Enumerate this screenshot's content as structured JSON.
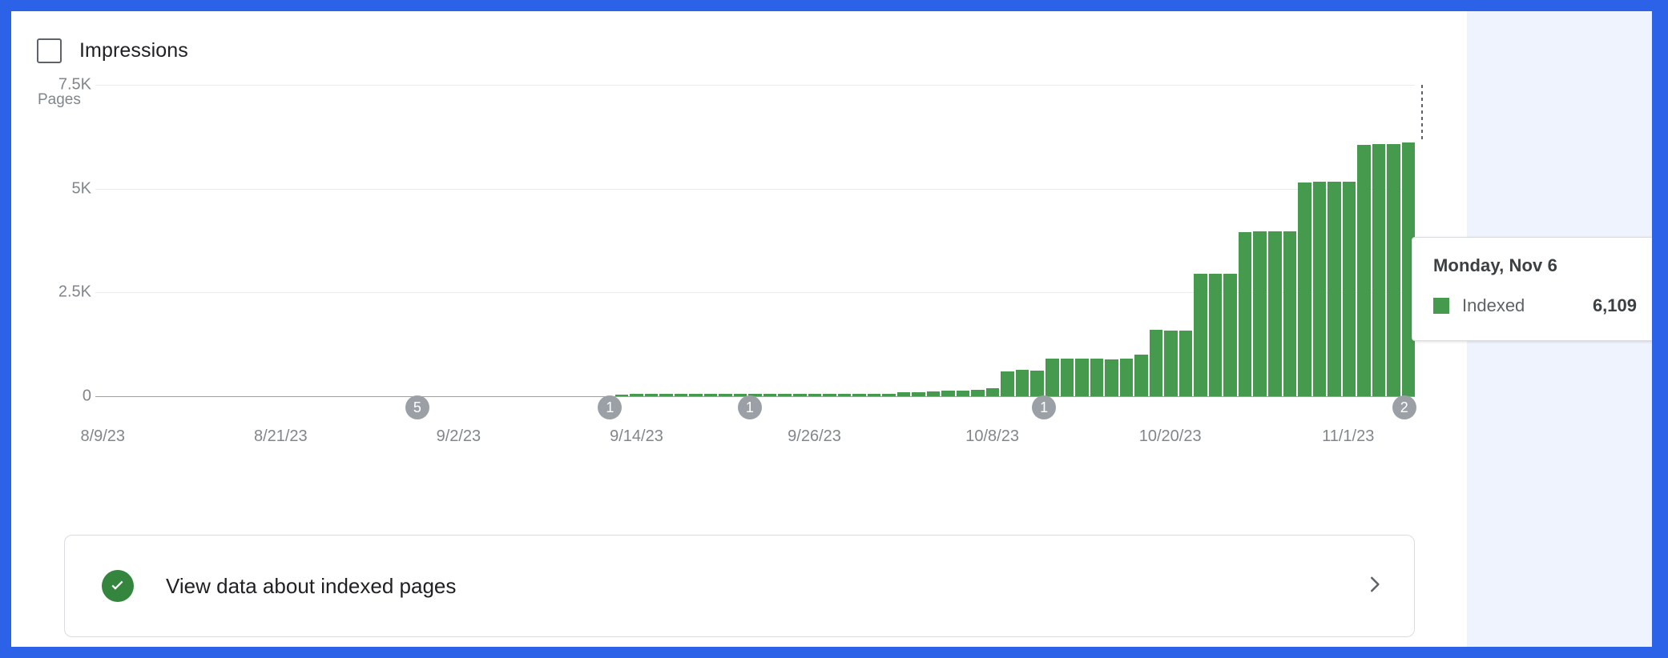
{
  "theme": {
    "page_border": "#2b62e8",
    "page_background": "#eef3fd",
    "card_background": "#ffffff",
    "bar_color": "#469a4e",
    "badge_color": "#9aa0a6",
    "axis_text": "#80868b",
    "success_green": "#34853d"
  },
  "legend": {
    "impressions_label": "Impressions",
    "impressions_checked": false
  },
  "tooltip": {
    "date": "Monday, Nov 6",
    "series_name": "Indexed",
    "value": "6,109",
    "swatch_color": "#469a4e"
  },
  "action_card": {
    "label": "View data about indexed pages",
    "icon": "check-circle-icon",
    "chevron": "chevron-right-icon"
  },
  "annotations": [
    {
      "label": "5",
      "x_percent": 24.4
    },
    {
      "label": "1",
      "x_percent": 39.0
    },
    {
      "label": "1",
      "x_percent": 49.6
    },
    {
      "label": "1",
      "x_percent": 71.9
    },
    {
      "label": "2",
      "x_percent": 99.2
    }
  ],
  "chart_data": {
    "type": "bar",
    "title": "",
    "xlabel": "",
    "ylabel": "Pages",
    "ylim": [
      0,
      7500
    ],
    "grid": true,
    "y_ticks": [
      "0",
      "2.5K",
      "5K",
      "7.5K"
    ],
    "y_tick_values": [
      0,
      2500,
      5000,
      7500
    ],
    "legend_position": "top-left",
    "series": [
      {
        "name": "Indexed",
        "color": "#469a4e"
      }
    ],
    "x_tick_labels": [
      "8/9/23",
      "8/21/23",
      "9/2/23",
      "9/14/23",
      "9/26/23",
      "10/8/23",
      "10/20/23",
      "11/1/23"
    ],
    "x_tick_positions": [
      0,
      12,
      24,
      36,
      48,
      60,
      72,
      84
    ],
    "categories": [
      "8/9/23",
      "8/10/23",
      "8/11/23",
      "8/12/23",
      "8/13/23",
      "8/14/23",
      "8/15/23",
      "8/16/23",
      "8/17/23",
      "8/18/23",
      "8/19/23",
      "8/20/23",
      "8/21/23",
      "8/22/23",
      "8/23/23",
      "8/24/23",
      "8/25/23",
      "8/26/23",
      "8/27/23",
      "8/28/23",
      "8/29/23",
      "8/30/23",
      "8/31/23",
      "9/1/23",
      "9/2/23",
      "9/3/23",
      "9/4/23",
      "9/5/23",
      "9/6/23",
      "9/7/23",
      "9/8/23",
      "9/9/23",
      "9/10/23",
      "9/11/23",
      "9/12/23",
      "9/13/23",
      "9/14/23",
      "9/15/23",
      "9/16/23",
      "9/17/23",
      "9/18/23",
      "9/19/23",
      "9/20/23",
      "9/21/23",
      "9/22/23",
      "9/23/23",
      "9/24/23",
      "9/25/23",
      "9/26/23",
      "9/27/23",
      "9/28/23",
      "9/29/23",
      "9/30/23",
      "10/1/23",
      "10/2/23",
      "10/3/23",
      "10/4/23",
      "10/5/23",
      "10/6/23",
      "10/7/23",
      "10/8/23",
      "10/9/23",
      "10/10/23",
      "10/11/23",
      "10/12/23",
      "10/13/23",
      "10/14/23",
      "10/15/23",
      "10/16/23",
      "10/17/23",
      "10/18/23",
      "10/19/23",
      "10/20/23",
      "10/21/23",
      "10/22/23",
      "10/23/23",
      "10/24/23",
      "10/25/23",
      "10/26/23",
      "10/27/23",
      "10/28/23",
      "10/29/23",
      "10/30/23",
      "10/31/23",
      "11/1/23",
      "11/2/23",
      "11/3/23",
      "11/4/23",
      "11/5/23",
      "11/6/23"
    ],
    "values": [
      0,
      0,
      0,
      0,
      0,
      0,
      0,
      0,
      0,
      0,
      0,
      0,
      0,
      0,
      0,
      0,
      0,
      0,
      0,
      0,
      0,
      0,
      0,
      0,
      0,
      0,
      0,
      0,
      0,
      0,
      0,
      0,
      0,
      0,
      0,
      40,
      55,
      55,
      55,
      55,
      55,
      55,
      55,
      55,
      55,
      55,
      55,
      55,
      55,
      55,
      55,
      55,
      55,
      60,
      90,
      100,
      110,
      130,
      140,
      150,
      190,
      600,
      640,
      620,
      900,
      900,
      900,
      900,
      880,
      900,
      1000,
      1600,
      1580,
      1580,
      2950,
      2950,
      2950,
      3950,
      3980,
      3980,
      3980,
      5150,
      5160,
      5160,
      5160,
      6050,
      6070,
      6070,
      6109
    ],
    "highlighted_index": 89,
    "highlighted_value": 6109,
    "highlighted_label": "Monday, Nov 6"
  }
}
